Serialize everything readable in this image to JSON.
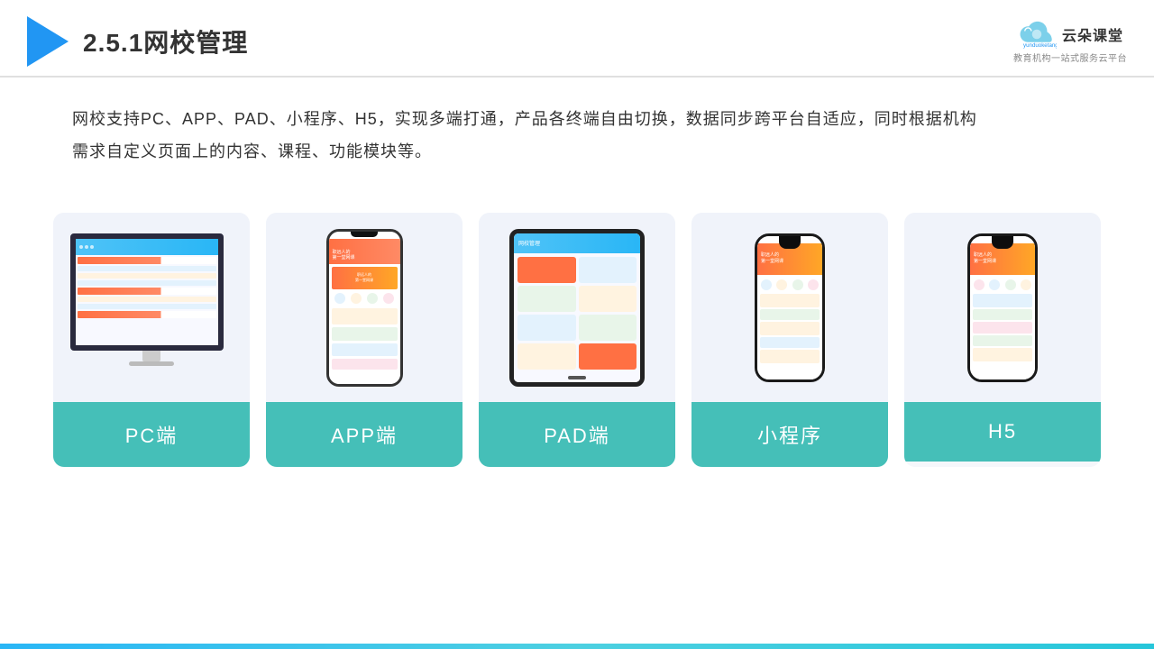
{
  "header": {
    "title": "2.5.1网校管理",
    "brand_name": "云朵课堂",
    "brand_url": "yunduoketang.com",
    "brand_tagline": "教育机构一站\n式服务云平台"
  },
  "description": {
    "text": "网校支持PC、APP、PAD、小程序、H5，实现多端打通，产品各终端自由切换，数据同步跨平台自适应，同时根据机构需求自定义页面上的内容、课程、功能模块等。"
  },
  "cards": [
    {
      "label": "PC端",
      "type": "pc"
    },
    {
      "label": "APP端",
      "type": "phone"
    },
    {
      "label": "PAD端",
      "type": "pad"
    },
    {
      "label": "小程序",
      "type": "phone-small"
    },
    {
      "label": "H5",
      "type": "phone-small2"
    }
  ]
}
